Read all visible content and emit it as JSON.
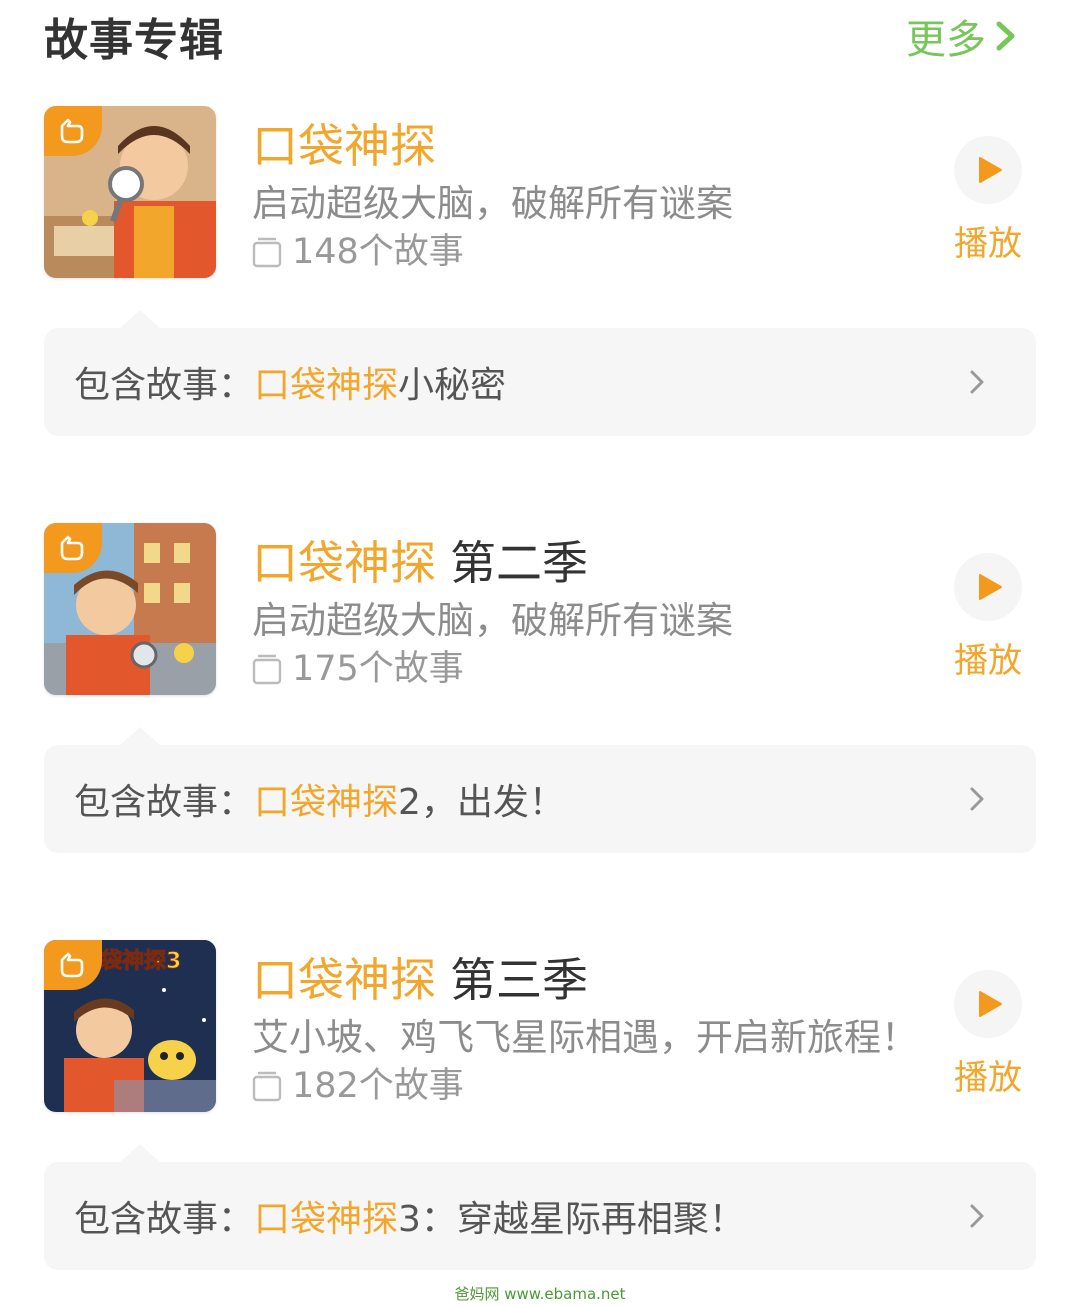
{
  "header": {
    "title": "故事专辑",
    "more_label": "更多"
  },
  "albums": [
    {
      "title_accent": "口袋神探",
      "title_rest": "",
      "description": "启动超级大脑，破解所有谜案",
      "count": "148个故事",
      "play_label": "播放",
      "contains_label": "包含故事：",
      "contains_accent": "口袋神探",
      "contains_rest": "小秘密"
    },
    {
      "title_accent": "口袋神探",
      "title_rest": "第二季",
      "description": "启动超级大脑，破解所有谜案",
      "count": "175个故事",
      "play_label": "播放",
      "contains_label": "包含故事：",
      "contains_accent": "口袋神探",
      "contains_rest": "2，出发！"
    },
    {
      "title_accent": "口袋神探",
      "title_rest": "第三季",
      "cover_text": "袋神探3",
      "description": "艾小坡、鸡飞飞星际相遇，开启新旅程！",
      "count": "182个故事",
      "play_label": "播放",
      "contains_label": "包含故事：",
      "contains_accent": "口袋神探",
      "contains_rest": "3：穿越星际再相聚！"
    }
  ],
  "watermark": "爸妈网 www.ebama.net",
  "colors": {
    "accent_orange": "#f2a72c",
    "more_green": "#78c55a",
    "badge_orange": "#f39a1e",
    "bar_background": "#f6f6f6"
  },
  "icons": [
    "chevron-right-icon",
    "badge-hand-icon",
    "play-icon",
    "album-count-icon"
  ]
}
